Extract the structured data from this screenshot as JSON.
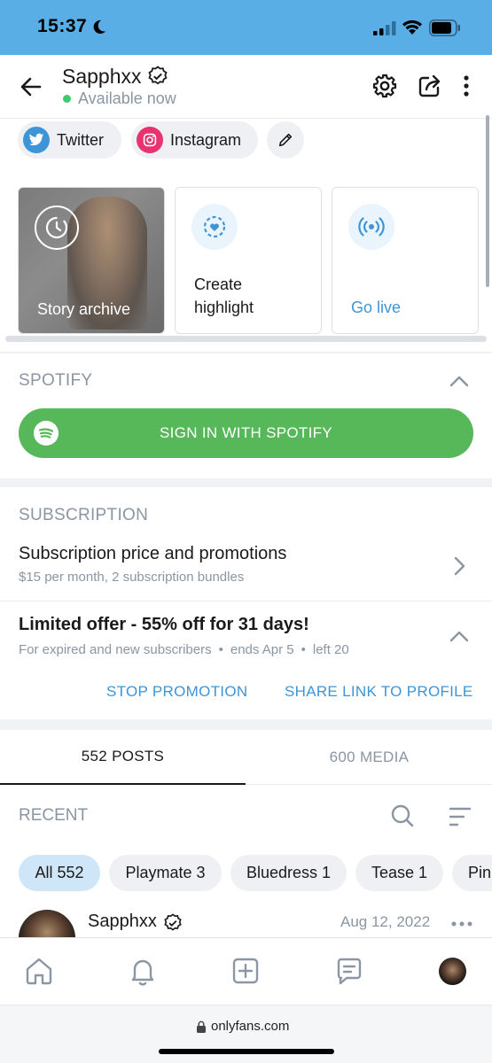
{
  "status_bar": {
    "time": "15:37"
  },
  "header": {
    "name": "Sapphxx",
    "availability": "Available now"
  },
  "social": {
    "twitter": "Twitter",
    "instagram": "Instagram"
  },
  "highlights": {
    "story_archive": "Story archive",
    "create_highlight_line1": "Create",
    "create_highlight_line2": "highlight",
    "go_live": "Go live"
  },
  "spotify": {
    "title": "SPOTIFY",
    "button": "SIGN IN WITH SPOTIFY"
  },
  "subscription": {
    "title": "SUBSCRIPTION",
    "item_title": "Subscription price and promotions",
    "item_meta": "$15 per month, 2 subscription bundles",
    "promo_title": "Limited offer - 55% off for 31 days!",
    "promo_audience": "For expired and new subscribers",
    "promo_ends": "ends Apr 5",
    "promo_left": "left 20",
    "stop_promotion": "STOP PROMOTION",
    "share_link": "SHARE LINK TO PROFILE"
  },
  "tabs": {
    "posts": "552 POSTS",
    "media": "600 MEDIA"
  },
  "recent": {
    "title": "RECENT",
    "filters": [
      "All 552",
      "Playmate 3",
      "Bluedress 1",
      "Tease 1",
      "Pin"
    ]
  },
  "post": {
    "author": "Sapphxx",
    "date": "Aug 12, 2022"
  },
  "browser": {
    "url": "onlyfans.com"
  },
  "colors": {
    "status_bar": "#5aaee6",
    "accent": "#3d94d6",
    "spotify_green": "#56b858",
    "online": "#41c96e",
    "muted": "#8a96a3"
  },
  "icons": [
    "moon-icon",
    "signal-icon",
    "wifi-icon",
    "battery-icon",
    "back-arrow-icon",
    "verified-icon",
    "gear-icon",
    "share-icon",
    "more-vertical-icon",
    "twitter-icon",
    "instagram-icon",
    "pencil-icon",
    "clock-icon",
    "heart-circle-icon",
    "live-broadcast-icon",
    "chevron-up-icon",
    "spotify-icon",
    "chevron-right-icon",
    "search-icon",
    "sort-icon",
    "more-horizontal-icon",
    "home-icon",
    "bell-icon",
    "add-icon",
    "chat-icon",
    "lock-icon"
  ]
}
